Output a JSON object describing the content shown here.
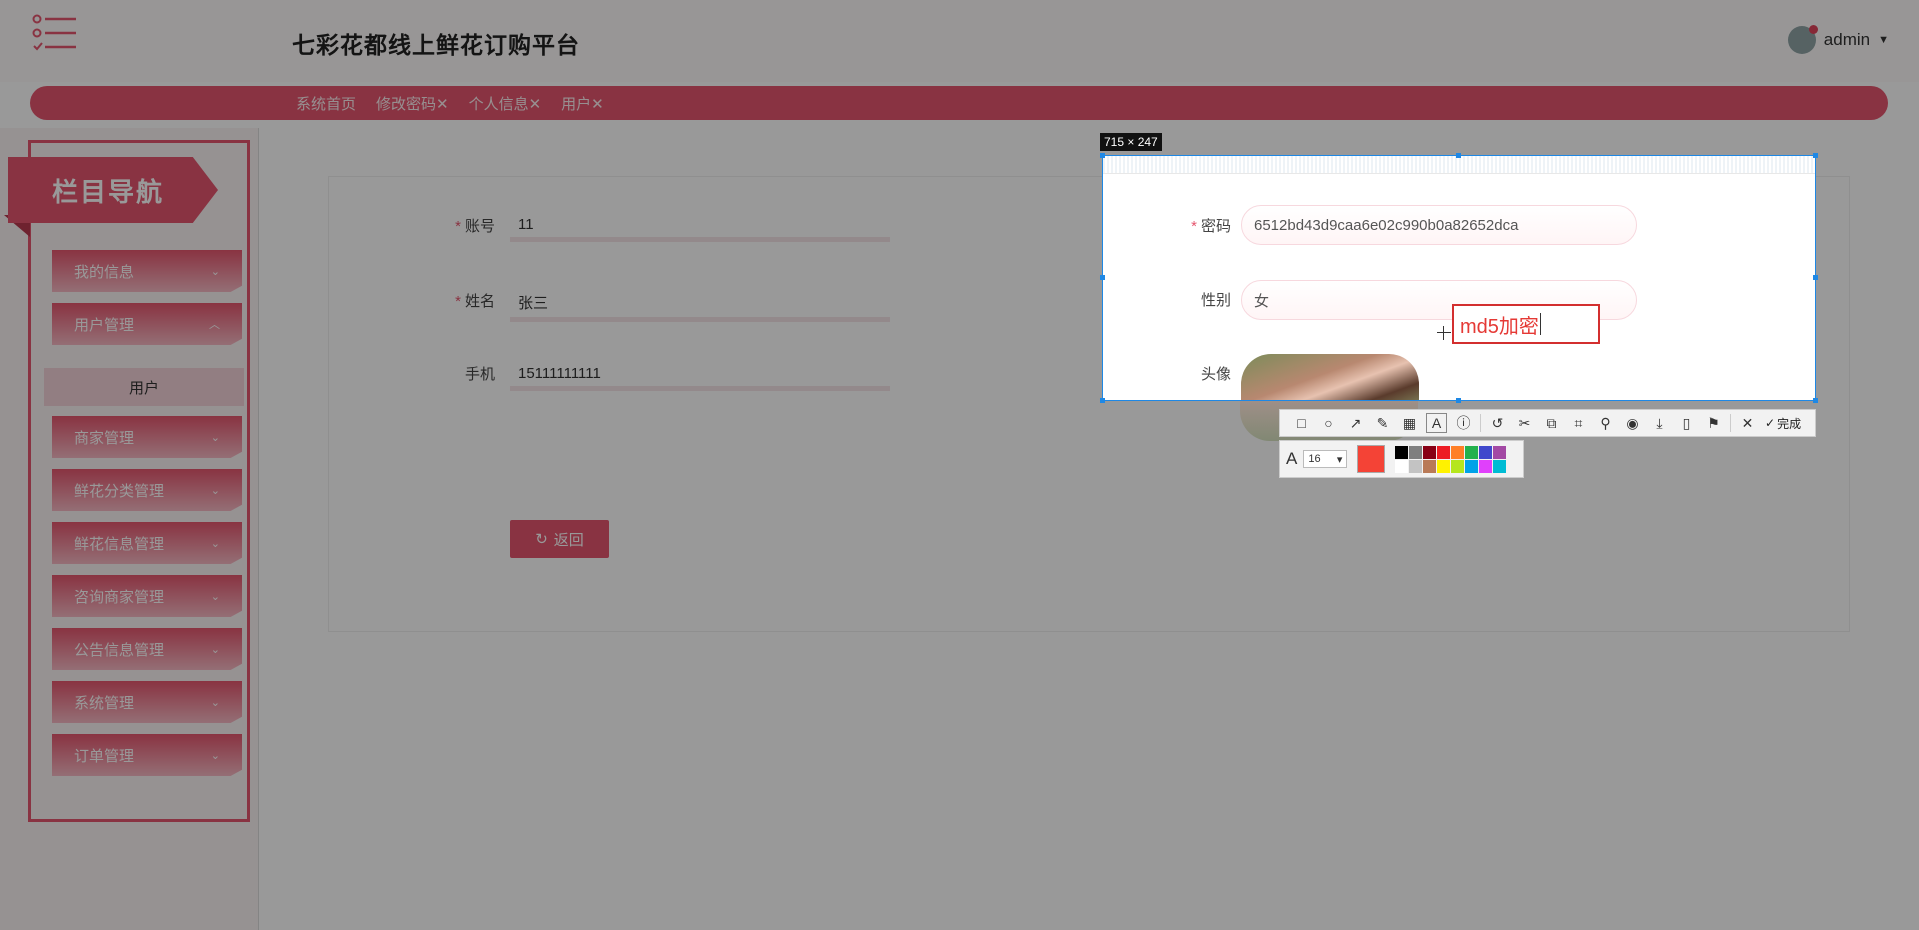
{
  "app": {
    "title": "七彩花都线上鲜花订购平台",
    "user": "admin",
    "user_caret": "▼"
  },
  "tabs": [
    "系统首页",
    "修改密码✕",
    "个人信息✕",
    "用户✕"
  ],
  "sidebar": {
    "banner": "栏目导航",
    "items": [
      {
        "label": "我的信息",
        "chev": "⌄"
      },
      {
        "label": "用户管理",
        "chev": "︿"
      },
      {
        "label": "商家管理",
        "chev": "⌄"
      },
      {
        "label": "鲜花分类管理",
        "chev": "⌄"
      },
      {
        "label": "鲜花信息管理",
        "chev": "⌄"
      },
      {
        "label": "咨询商家管理",
        "chev": "⌄"
      },
      {
        "label": "公告信息管理",
        "chev": "⌄"
      },
      {
        "label": "系统管理",
        "chev": "⌄"
      },
      {
        "label": "订单管理",
        "chev": "⌄"
      }
    ],
    "sub_item": "用户"
  },
  "form": {
    "account_label": "账号",
    "account_value": "11",
    "name_label": "姓名",
    "name_value": "张三",
    "phone_label": "手机",
    "phone_value": "15111111111",
    "required_mark": "*",
    "back_label": "返回",
    "back_icon": "↻"
  },
  "capture": {
    "size_label": "715 × 247",
    "password_label": "密码",
    "password_value": "6512bd43d9caa6e02c990b0a82652dca",
    "gender_label": "性别",
    "gender_value": "女",
    "avatar_label": "头像",
    "annotation_text": "md5加密",
    "font_size": "16",
    "font_icon": "A",
    "font_caret": "▾",
    "done_label": "完成",
    "done_icon": "✓",
    "current_color": "#f44336",
    "tools": [
      "□",
      "○",
      "↗",
      "✎",
      "▦",
      "A",
      "ⓘ",
      "↺",
      "✂",
      "⧉",
      "⌗",
      "⚲",
      "◉",
      "⤓",
      "▯",
      "⚑",
      "✕"
    ],
    "palette": [
      "#000000",
      "#7f7f7f",
      "#880015",
      "#ed1c24",
      "#ff7f27",
      "#22b14c",
      "#3f48cc",
      "#a349a4",
      "#ffffff",
      "#c3c3c3",
      "#b97a57",
      "#fff200",
      "#b5e61d",
      "#00a2e8",
      "#e040fb",
      "#00bcd4"
    ]
  }
}
